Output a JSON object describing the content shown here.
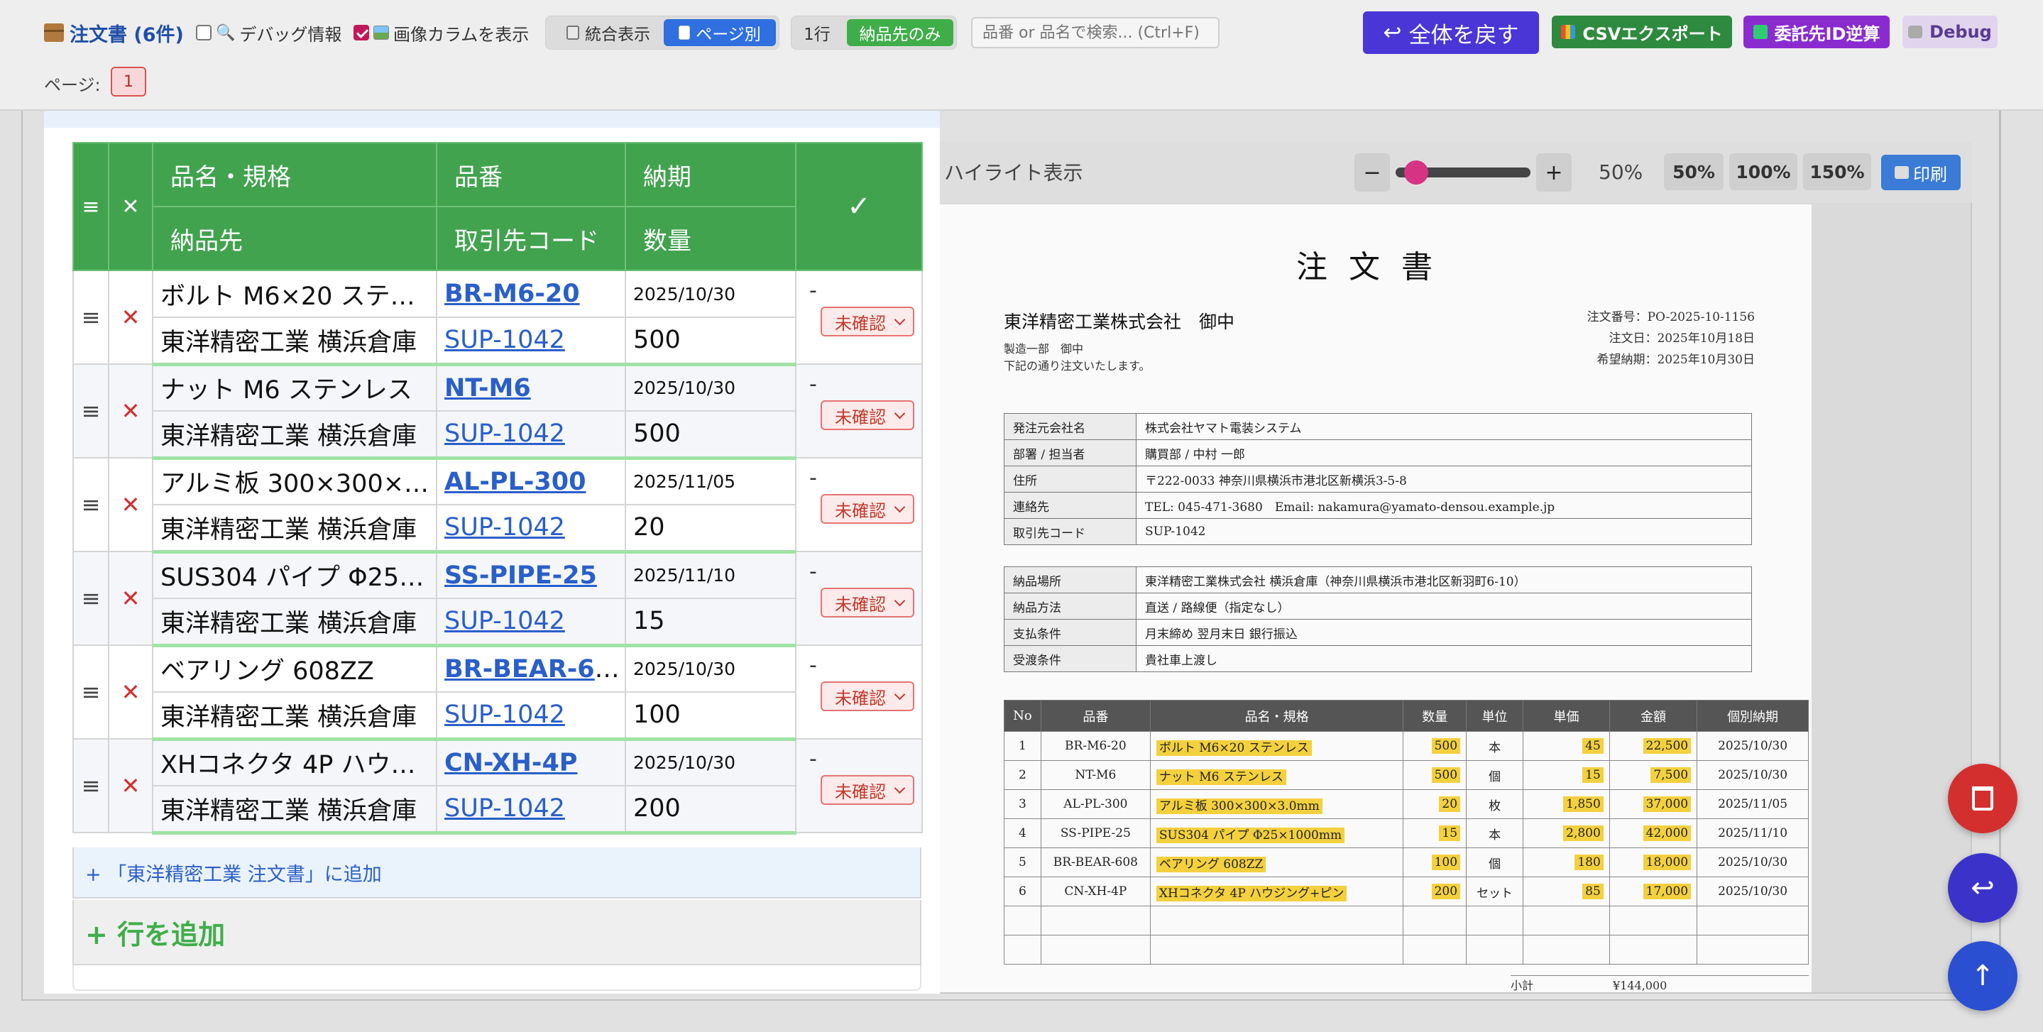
{
  "toolbar": {
    "title": "注文書 (6件)",
    "debug_info_label": "デバッグ情報",
    "debug_info_checked": false,
    "image_column_label": "画像カラムを表示",
    "image_column_checked": true,
    "view_merged": "統合表示",
    "view_by_page": "ページ別",
    "rows_1": "1行",
    "delivery_only": "納品先のみ",
    "search_placeholder": "品番 or 品名で検索... (Ctrl+F)",
    "reset_all": "全体を戻す",
    "csv_export": "CSVエクスポート",
    "consignee_reverse": "委託先ID逆算",
    "debug": "Debug",
    "page_label": "ページ:",
    "page_number": "1"
  },
  "preview": {
    "highlight_label": "ハイライト表示",
    "minus": "−",
    "plus": "+",
    "zoom_value": "50%",
    "zoom_fraction": 0.08,
    "presets": [
      "50%",
      "100%",
      "150%"
    ],
    "print": "印刷"
  },
  "document": {
    "title": "注文書",
    "to": "東洋精密工業株式会社　御中",
    "dept": "製造一部　御中",
    "note": "下記の通り注文いたします。",
    "order_no": "注文番号：PO-2025-10-1156",
    "order_date": "注文日：2025年10月18日",
    "desired_delivery": "希望納期：2025年10月30日",
    "info_rows": [
      {
        "k": "発注元会社名",
        "v": "株式会社ヤマト電装システム"
      },
      {
        "k": "部署 / 担当者",
        "v": "購買部 / 中村 一郎"
      },
      {
        "k": "住所",
        "v": "〒222-0033 神奈川県横浜市港北区新横浜3-5-8"
      },
      {
        "k": "連絡先",
        "v": "TEL: 045-471-3680　Email: nakamura@yamato-densou.example.jp"
      },
      {
        "k": "取引先コード",
        "v": "SUP-1042"
      }
    ],
    "delivery_rows": [
      {
        "k": "納品場所",
        "v": "東洋精密工業株式会社 横浜倉庫（神奈川県横浜市港北区新羽町6-10）"
      },
      {
        "k": "納品方法",
        "v": "直送 / 路線便（指定なし）"
      },
      {
        "k": "支払条件",
        "v": "月末締め 翌月末日 銀行振込"
      },
      {
        "k": "受渡条件",
        "v": "貴社車上渡し"
      }
    ],
    "item_headers": [
      "No",
      "品番",
      "品名・規格",
      "数量",
      "単位",
      "単価",
      "金額",
      "個別納期"
    ],
    "items": [
      {
        "no": "1",
        "code": "BR-M6-20",
        "name": "ボルト M6×20 ステンレス",
        "qty": "500",
        "unit": "本",
        "price": "45",
        "amount": "22,500",
        "due": "2025/10/30"
      },
      {
        "no": "2",
        "code": "NT-M6",
        "name": "ナット M6 ステンレス",
        "qty": "500",
        "unit": "個",
        "price": "15",
        "amount": "7,500",
        "due": "2025/10/30"
      },
      {
        "no": "3",
        "code": "AL-PL-300",
        "name": "アルミ板 300×300×3.0mm",
        "qty": "20",
        "unit": "枚",
        "price": "1,850",
        "amount": "37,000",
        "due": "2025/11/05"
      },
      {
        "no": "4",
        "code": "SS-PIPE-25",
        "name": "SUS304 パイプ Φ25×1000mm",
        "qty": "15",
        "unit": "本",
        "price": "2,800",
        "amount": "42,000",
        "due": "2025/11/10"
      },
      {
        "no": "5",
        "code": "BR-BEAR-608",
        "name": "ベアリング 608ZZ",
        "qty": "100",
        "unit": "個",
        "price": "180",
        "amount": "18,000",
        "due": "2025/10/30"
      },
      {
        "no": "6",
        "code": "CN-XH-4P",
        "name": "XHコネクタ 4P ハウジング+ピン",
        "qty": "200",
        "unit": "セット",
        "price": "85",
        "amount": "17,000",
        "due": "2025/10/30"
      }
    ],
    "tail": "小計　　　　　　　¥144,000"
  },
  "grid": {
    "headers": {
      "drag": "≡",
      "del": "✕",
      "name": "品名・規格",
      "code": "品番",
      "due": "納期",
      "check": "✓",
      "dest": "納品先",
      "supplier": "取引先コード",
      "qty": "数量"
    },
    "rows": [
      {
        "name": "ボルト M6×20 ステンレス",
        "code": "BR-M6-20",
        "due": "2025/10/30",
        "dest": "東洋精密工業 横浜倉庫",
        "supplier": "SUP-1042",
        "qty": "500",
        "dash": "-",
        "status": "未確認"
      },
      {
        "name": "ナット M6 ステンレス",
        "code": "NT-M6",
        "due": "2025/10/30",
        "dest": "東洋精密工業 横浜倉庫",
        "supplier": "SUP-1042",
        "qty": "500",
        "dash": "-",
        "status": "未確認"
      },
      {
        "name": "アルミ板 300×300×3.0mm",
        "code": "AL-PL-300",
        "due": "2025/11/05",
        "dest": "東洋精密工業 横浜倉庫",
        "supplier": "SUP-1042",
        "qty": "20",
        "dash": "-",
        "status": "未確認"
      },
      {
        "name": "SUS304 パイプ Φ25×1000mm",
        "code": "SS-PIPE-25",
        "due": "2025/11/10",
        "dest": "東洋精密工業 横浜倉庫",
        "supplier": "SUP-1042",
        "qty": "15",
        "dash": "-",
        "status": "未確認"
      },
      {
        "name": "ベアリング 608ZZ",
        "code": "BR-BEAR-608",
        "due": "2025/10/30",
        "dest": "東洋精密工業 横浜倉庫",
        "supplier": "SUP-1042",
        "qty": "100",
        "dash": "-",
        "status": "未確認"
      },
      {
        "name": "XHコネクタ 4P ハウジング+ピン",
        "code": "CN-XH-4P",
        "due": "2025/10/30",
        "dest": "東洋精密工業 横浜倉庫",
        "supplier": "SUP-1042",
        "qty": "200",
        "dash": "-",
        "status": "未確認"
      }
    ],
    "add_to_group": "+ 「東洋精密工業 注文書」に追加",
    "add_row": "+ 行を追加"
  },
  "fabs": {
    "delete_icon": "trash-icon",
    "undo_icon": "undo-icon",
    "up_icon": "arrow-up-icon"
  },
  "colors": {
    "header_green": "#41a34e",
    "primary_purple": "#4a35d6",
    "csv_green": "#2e8a3e",
    "consignee_purple": "#8a2bd0",
    "fab_red": "#d32f2f",
    "fab_blue": "#2a4fd0"
  }
}
